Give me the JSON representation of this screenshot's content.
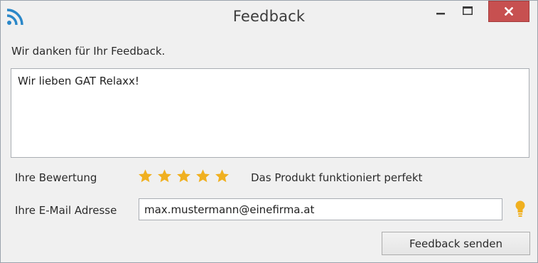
{
  "window": {
    "title": "Feedback",
    "icon": "rss-feed-icon",
    "controls": [
      "minimize-icon",
      "maximize-icon",
      "close-icon"
    ],
    "close_color": "#c75050"
  },
  "form": {
    "thanks_text": "Wir danken für Ihr Feedback.",
    "feedback_value": "Wir lieben GAT Relaxx!",
    "rating_label": "Ihre Bewertung",
    "rating": 5,
    "rating_max": 5,
    "star_color": "#f0b020",
    "rating_description": "Das Produkt funktioniert perfekt",
    "email_label": "Ihre E-Mail Adresse",
    "email_value": "max.mustermann@einefirma.at",
    "hint_icon": "lightbulb-icon",
    "send_label": "Feedback senden"
  }
}
